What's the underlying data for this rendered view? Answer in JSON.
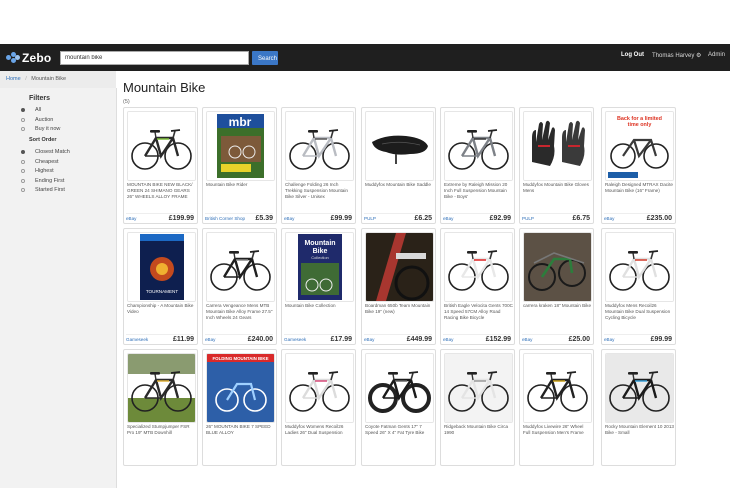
{
  "header": {
    "logo_text": "Zebo",
    "search_value": "mountain bike",
    "search_button": "Search",
    "logout": "Log Out",
    "user_name": "Thomas Harvey ⚙",
    "admin": "Admin"
  },
  "breadcrumb": {
    "home": "Home",
    "separator": "/",
    "current": "Mountain Bike"
  },
  "sidebar": {
    "filters_title": "Filters",
    "filters": [
      {
        "label": "All",
        "selected": true
      },
      {
        "label": "Auction",
        "selected": false
      },
      {
        "label": "Buy it now",
        "selected": false
      }
    ],
    "sort_title": "Sort Order",
    "sort_options": [
      {
        "label": "Closest Match",
        "selected": true
      },
      {
        "label": "Cheapest",
        "selected": false
      },
      {
        "label": "Highest",
        "selected": false
      },
      {
        "label": "Ending First",
        "selected": false
      },
      {
        "label": "Started First",
        "selected": false
      }
    ]
  },
  "main": {
    "title": "Mountain Bike",
    "count": "(5)"
  },
  "products": [
    {
      "title": "MOUNTAIN BIKE NEW BLACK/ GREEN 24 SHIMANO GEARS 26\" WHEELS ALLOY FRAME",
      "seller": "eBay",
      "price": "£199.99",
      "image": "bike-black-green"
    },
    {
      "title": "Mountain Bike Rider",
      "seller": "British Corner Shop",
      "price": "£5.39",
      "image": "magazine-mbr"
    },
    {
      "title": "Challenge Folding 26 Inch Trekking Suspension Mountain Bike Silver - Unisex",
      "seller": "eBay",
      "price": "£99.99",
      "image": "bike-silver"
    },
    {
      "title": "Muddyfox Mountain Bike Saddle",
      "seller": "PULP",
      "price": "£6.25",
      "image": "saddle"
    },
    {
      "title": "Extreme by Raleigh Mission 20 Inch Full Suspension Mountain Bike - Boys'",
      "seller": "eBay",
      "price": "£92.99",
      "image": "bike-grey"
    },
    {
      "title": "Muddyfox Mountain Bike Gloves Mens",
      "seller": "PULP",
      "price": "£6.75",
      "image": "gloves"
    },
    {
      "title": "Raleigh Designed MTRAX Dacite Mountain Bike (16\" Frame)",
      "seller": "eBay",
      "price": "£235.00",
      "image": "bike-limited-offer"
    },
    {
      "title": "Championship - A Mountain Bike Video",
      "seller": "Gameseek",
      "price": "£11.99",
      "image": "dvd-cover"
    },
    {
      "title": "Carrera Vengeance Mens MTB Mountain Bike Alloy Frame 27.5\" Inch Wheels 24 Gears",
      "seller": "eBay",
      "price": "£240.00",
      "image": "bike-black"
    },
    {
      "title": "Mountain Bike Collection",
      "seller": "Gameseek",
      "price": "£17.99",
      "image": "dvd-collection"
    },
    {
      "title": "Boardman 650b Team Mountain Bike 19\" (new)",
      "seller": "eBay",
      "price": "£449.99",
      "image": "bike-closeup-red"
    },
    {
      "title": "British Eagle Velocita Gents 700C 14 Speed 57CM Alloy Road Racing Bike Bicycle",
      "seller": "eBay",
      "price": "£152.99",
      "image": "bike-white-road"
    },
    {
      "title": "carrera kraken 18\" Mountain Bike",
      "seller": "eBay",
      "price": "£25.00",
      "image": "bike-stack"
    },
    {
      "title": "Muddyfox Mens Recoil26 Mountain Bike Dual Suspension Cycling Bicycle",
      "seller": "eBay",
      "price": "£99.99",
      "image": "bike-white-red"
    },
    {
      "title": "Specialized Stumpjumper FSR Pro 19\" MTB Downhill",
      "seller": "",
      "price": "",
      "image": "bike-outdoor-garden"
    },
    {
      "title": "26\" MOUNTAIN BIKE 7 SPEED BLUE ALLOY",
      "seller": "",
      "price": "",
      "image": "folding-bike-poster"
    },
    {
      "title": "Muddyfox Womens Recoil26 Ladies 26\" Dual Suspension",
      "seller": "",
      "price": "",
      "image": "bike-white-ladies"
    },
    {
      "title": "Coyote Fatman Gents 17\" 7 Speed 26\" X 4\" Fat Tyre Bike",
      "seller": "",
      "price": "",
      "image": "fat-bike"
    },
    {
      "title": "Ridgeback Mountain Bike Circa 1990",
      "seller": "",
      "price": "",
      "image": "bike-white-vintage"
    },
    {
      "title": "Muddyfox Livewire 26\" Wheel Full Suspension Men's Frame",
      "seller": "",
      "price": "",
      "image": "bike-black-mens"
    },
    {
      "title": "Rocky Mountain Element 10 2013 Bike - Small",
      "seller": "",
      "price": "",
      "image": "bike-rocky"
    }
  ],
  "colors": {
    "header_bg": "#1f1f1f",
    "link": "#2f6fb8",
    "search_button": "#3b77c6"
  }
}
